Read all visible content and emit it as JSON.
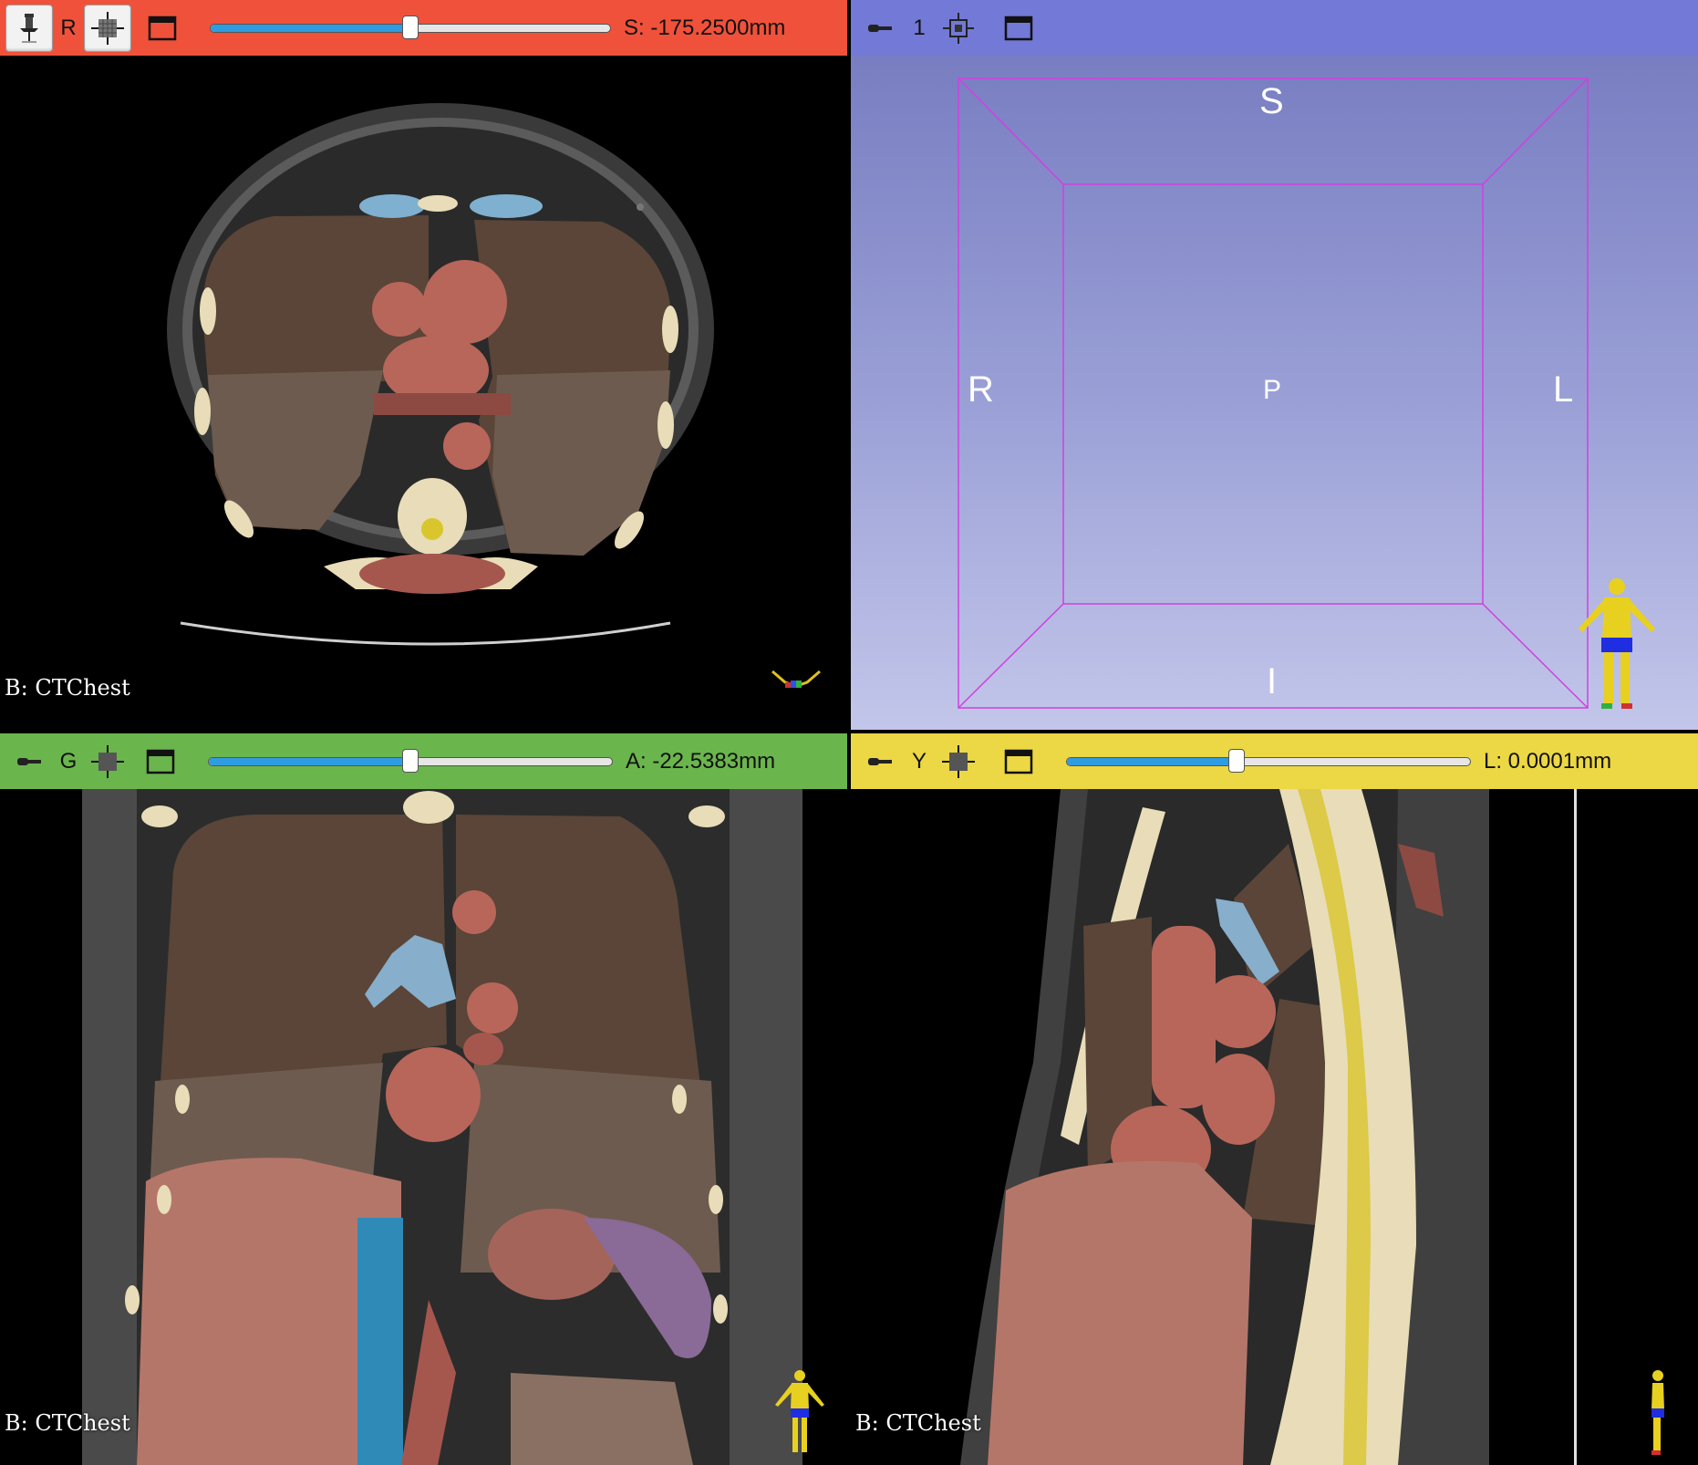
{
  "views": {
    "red": {
      "orientation_letter": "R",
      "slider_value": 0.5,
      "offset_readout": "S: -175.2500mm",
      "volume_label": "B: CTChest",
      "bar_color": "#f0513a"
    },
    "threed": {
      "view_number": "1",
      "orientation_labels": {
        "superior": "S",
        "inferior": "I",
        "right": "R",
        "left": "L",
        "posterior": "P"
      },
      "bar_color": "#7379d6",
      "bounding_box_color": "#d23fe0"
    },
    "green": {
      "orientation_letter": "G",
      "slider_value": 0.5,
      "offset_readout": "A: -22.5383mm",
      "volume_label": "B: CTChest",
      "bar_color": "#6bb54d"
    },
    "yellow": {
      "orientation_letter": "Y",
      "slider_value": 0.5,
      "offset_readout": "L: 0.0001mm",
      "volume_label": "B: CTChest",
      "bar_color": "#ecd744"
    }
  },
  "icons": {
    "pin": "pin-icon",
    "link": "link-icon",
    "slice_visibility": "slice-visibility-icon",
    "center": "center-view-icon",
    "window": "window-layout-icon",
    "human_figure": "human-orientation-figure-icon"
  }
}
